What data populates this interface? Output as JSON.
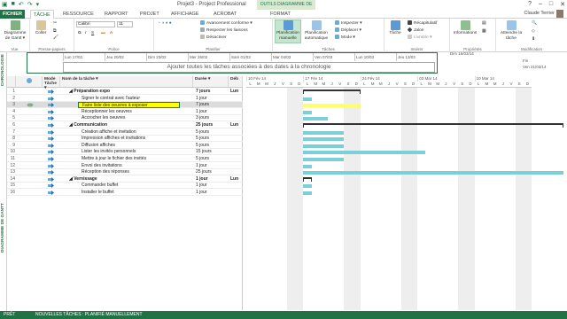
{
  "window": {
    "title": "Projet3 - Project Professional",
    "context_group": "OUTILS DIAGRAMME DE GANTT",
    "user": "Claude Terrier",
    "controls": [
      "?",
      "–",
      "□",
      "✕"
    ]
  },
  "tabs": [
    "FICHIER",
    "TÂCHE",
    "RESSOURCE",
    "RAPPORT",
    "PROJET",
    "AFFICHAGE",
    "ACROBAT",
    "FORMAT"
  ],
  "ribbon": {
    "vue": {
      "btn": "Diagramme de Gantt ▾",
      "label": "Vue"
    },
    "presse": {
      "btn": "Coller",
      "label": "Presse-papiers"
    },
    "police": {
      "font": "Calibri",
      "size": "11",
      "label": "Police"
    },
    "planifier": {
      "items": [
        "Avancement conforme ▾",
        "Respecter les liaisons",
        "Désactiver"
      ],
      "label": "Planifier"
    },
    "taches": {
      "manual": "Planification manuelle",
      "auto": "Planification automatique",
      "items": [
        "Inspecter ▾",
        "Déplacer ▾",
        "Mode ▾"
      ],
      "label": "Tâches"
    },
    "inserer": {
      "btn": "Tâche",
      "items": [
        "Récapitulatif",
        "Jalon",
        "Livrable ▾"
      ],
      "label": "Insérer"
    },
    "proprietes": {
      "btn": "Informations",
      "label": "Propriétés"
    },
    "modification": {
      "btn": "Atteindre la tâche",
      "label": "Modification"
    }
  },
  "sidebar": {
    "chronologie": "CHRONOLOGIE",
    "gantt": "DIAGRAMME DE GANTT"
  },
  "timeline": {
    "dates": [
      "Lun 17/02",
      "Jeu 20/02",
      "Dim 23/02",
      "Mer 26/02",
      "Sam 01/03",
      "Mar 04/03",
      "Ven 07/03",
      "Lun 10/03",
      "Jeu 13/03"
    ],
    "start_label": "Début",
    "start_date": "Lun 17/02/14",
    "end_label": "Fin",
    "end_date": "Ven 21/03/14",
    "end_top": "Dim 16/03/14",
    "placeholder": "Ajouter toutes les tâches associées à des dates à la chronologie"
  },
  "grid": {
    "headers": {
      "info": "ℹ",
      "mode": "Mode Tâche ▾",
      "name": "Nom de la tâche ▾",
      "duration": "Durée ▾",
      "start": "Déb"
    },
    "rows": [
      {
        "n": "1",
        "name": "Préparation expo",
        "dur": "7 jours",
        "start": "Lun",
        "summary": true,
        "level": 0
      },
      {
        "n": "2",
        "name": "Signer le contrat avec l'auteur",
        "dur": "1 jour",
        "start": "",
        "level": 1
      },
      {
        "n": "3",
        "name": "Faire liste des oeuvres à exposer",
        "dur": "7 jours",
        "start": "",
        "level": 1,
        "selected": true
      },
      {
        "n": "4",
        "name": "Réceptionner les oeuvres",
        "dur": "1 jour",
        "start": "",
        "level": 1
      },
      {
        "n": "5",
        "name": "Accrocher les oeuvres",
        "dur": "3 jours",
        "start": "",
        "level": 1
      },
      {
        "n": "6",
        "name": "Communication",
        "dur": "25 jours",
        "start": "Lun",
        "summary": true,
        "level": 0
      },
      {
        "n": "7",
        "name": "Création affiche  et invitation",
        "dur": "5 jours",
        "start": "",
        "level": 1
      },
      {
        "n": "8",
        "name": "Impression affiches et invitations",
        "dur": "5 jours",
        "start": "",
        "level": 1
      },
      {
        "n": "9",
        "name": "Diffusion affiches",
        "dur": "5 jours",
        "start": "",
        "level": 1
      },
      {
        "n": "10",
        "name": "Lister les invités personnels",
        "dur": "15 jours",
        "start": "",
        "level": 1
      },
      {
        "n": "11",
        "name": "Mettre à jour le fichier des invités",
        "dur": "5 jours",
        "start": "",
        "level": 1
      },
      {
        "n": "12",
        "name": "Envoi des invitations",
        "dur": "1 jour",
        "start": "",
        "level": 1
      },
      {
        "n": "13",
        "name": "Réception des réponses",
        "dur": "25 jours",
        "start": "",
        "level": 1
      },
      {
        "n": "14",
        "name": "Vernissage",
        "dur": "1 jour",
        "start": "Lun",
        "summary": true,
        "level": 0
      },
      {
        "n": "15",
        "name": "Commander buffet",
        "dur": "1 jour",
        "start": "",
        "level": 1
      },
      {
        "n": "16",
        "name": "Installer le buffet",
        "dur": "1 jour",
        "start": "",
        "level": 1
      }
    ]
  },
  "chart": {
    "weeks": [
      "10 Fév 14",
      "17 Fév 14",
      "24 Fév 14",
      "03 Mar 14",
      "10 Mar 14"
    ],
    "days": [
      "L",
      "M",
      "M",
      "J",
      "V",
      "S",
      "D"
    ],
    "bar_spans_days": [
      null,
      [
        7,
        8
      ],
      [
        7,
        14
      ],
      [
        7,
        8
      ],
      [
        7,
        10
      ],
      null,
      [
        7,
        12
      ],
      [
        7,
        12
      ],
      [
        7,
        12
      ],
      [
        7,
        22
      ],
      [
        7,
        12
      ],
      [
        7,
        8
      ],
      [
        7,
        39
      ],
      null,
      [
        7,
        8
      ],
      [
        7,
        8
      ]
    ],
    "summary_spans_days": [
      [
        7,
        14
      ],
      null,
      null,
      null,
      null,
      [
        7,
        39
      ],
      null,
      null,
      null,
      null,
      null,
      null,
      null,
      [
        7,
        8
      ],
      null,
      null
    ]
  },
  "status": {
    "left": "PRÊT",
    "mode": "NOUVELLES TÂCHES : PLANIFIÉ MANUELLEMENT"
  },
  "colors": {
    "accent": "#217346",
    "bar": "#7bcfd6",
    "highlight": "#ffff00"
  }
}
